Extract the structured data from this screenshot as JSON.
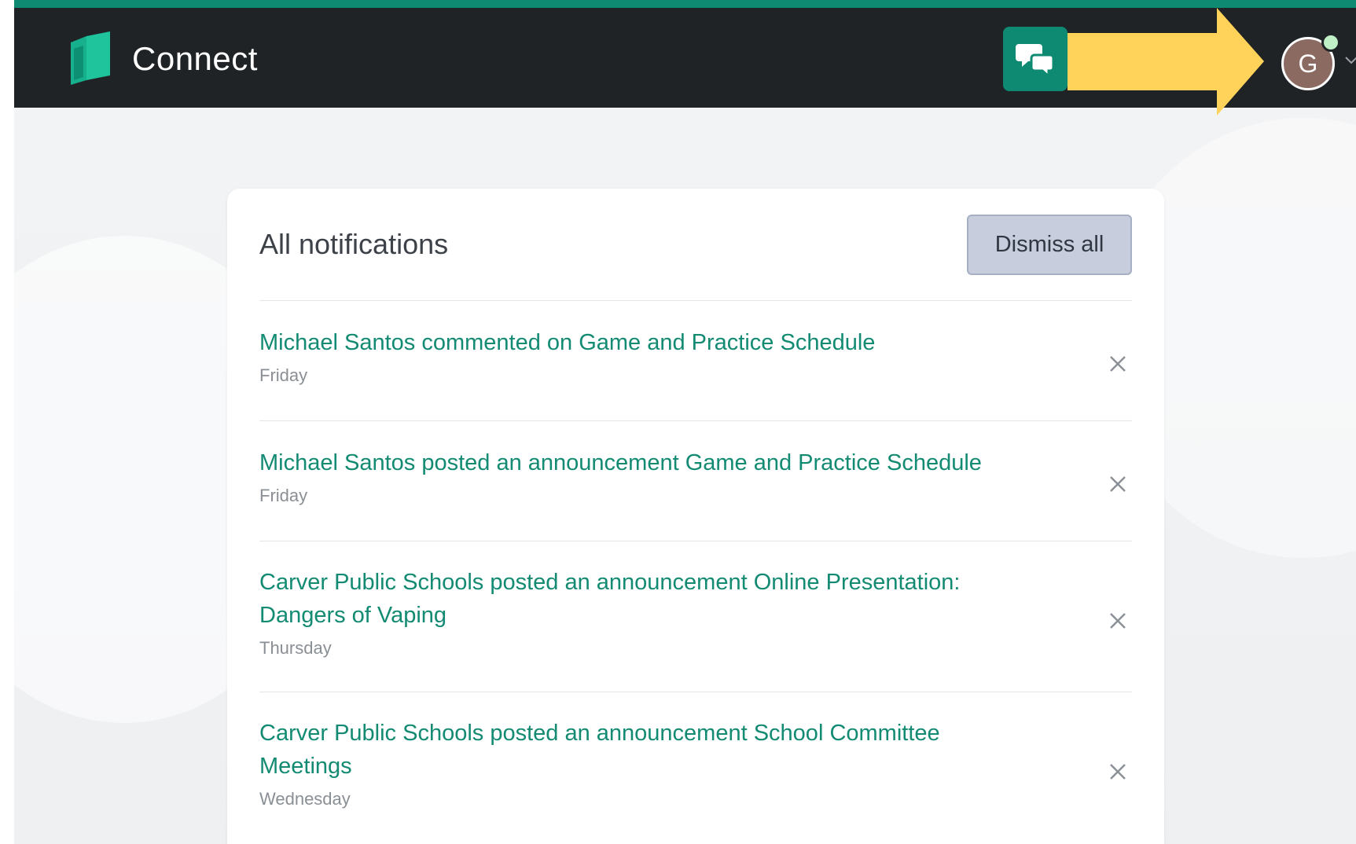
{
  "header": {
    "app_name": "Connect",
    "avatar_initial": "G",
    "accent_color": "#0e8a73"
  },
  "notifications": {
    "title": "All notifications",
    "dismiss_all_label": "Dismiss all",
    "items": [
      {
        "text": "Michael Santos commented on Game and Practice Schedule",
        "time": "Friday"
      },
      {
        "text": "Michael Santos posted an announcement Game and Practice Schedule",
        "time": "Friday"
      },
      {
        "text": "Carver Public Schools posted an announcement Online Presentation: Dangers of Vaping",
        "time": "Thursday"
      },
      {
        "text": "Carver Public Schools posted an announcement School Committee Meetings",
        "time": "Wednesday"
      }
    ]
  },
  "icons": {
    "logo": "book-logo-icon",
    "chat": "chat-bubbles-icon",
    "dropdown": "chevron-down-icon",
    "dismiss": "close-icon"
  }
}
